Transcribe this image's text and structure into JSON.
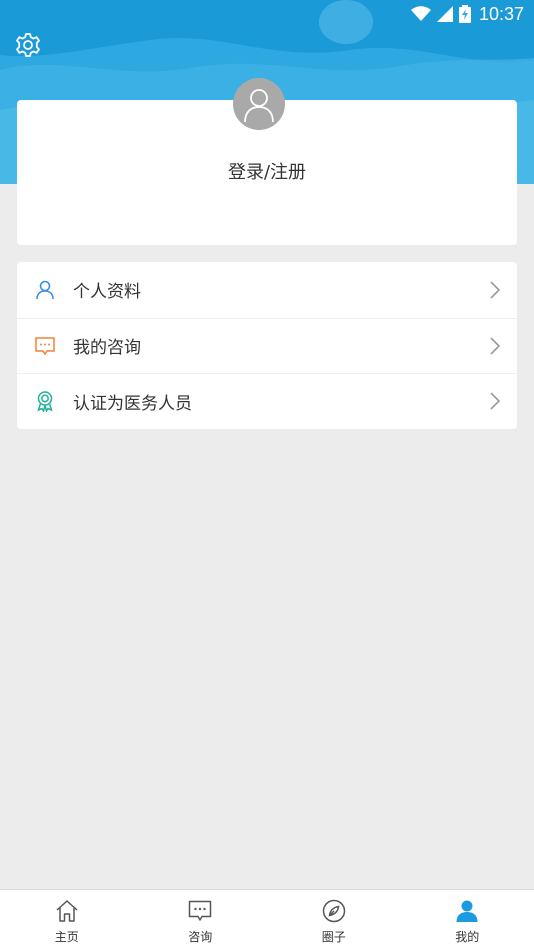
{
  "status_bar": {
    "time": "10:37"
  },
  "theme": {
    "accent": "#2ea8e0",
    "icon_gray": "#555555",
    "avatar_gray": "#a9a9a9"
  },
  "header": {
    "settings_icon": "gear-icon"
  },
  "profile": {
    "login_label": "登录/注册",
    "avatar_icon": "user-avatar-icon"
  },
  "menu": {
    "items": [
      {
        "label": "个人资料",
        "icon": "person-icon",
        "color": "#3a8ee6"
      },
      {
        "label": "我的咨询",
        "icon": "chat-bubble-icon",
        "color": "#f0823c"
      },
      {
        "label": "认证为医务人员",
        "icon": "award-badge-icon",
        "color": "#20b39a"
      }
    ]
  },
  "tabs": [
    {
      "label": "主页",
      "icon": "home-icon",
      "active": false
    },
    {
      "label": "咨询",
      "icon": "chat-icon",
      "active": false
    },
    {
      "label": "圈子",
      "icon": "compass-icon",
      "active": false
    },
    {
      "label": "我的",
      "icon": "user-icon",
      "active": true
    }
  ]
}
